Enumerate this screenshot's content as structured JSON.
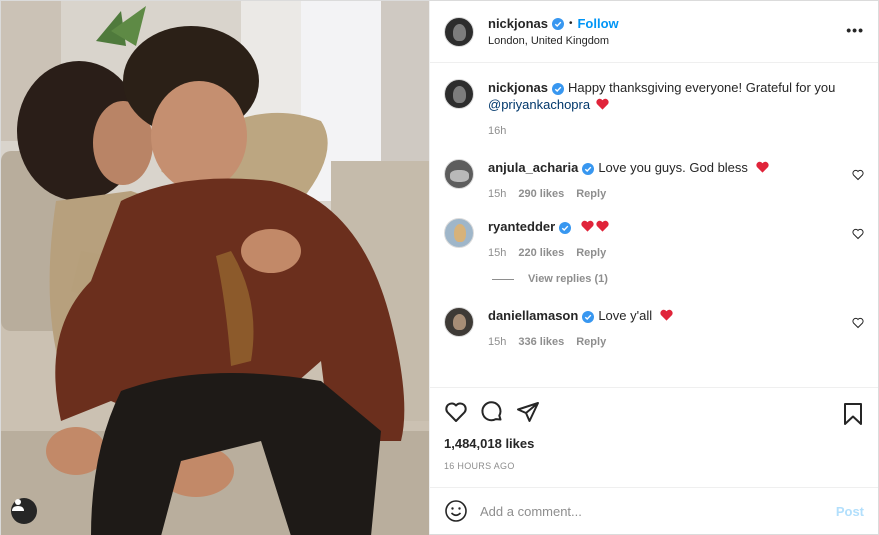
{
  "header": {
    "username": "nickjonas",
    "dot": "•",
    "follow_label": "Follow",
    "location": "London, United Kingdom",
    "more_label": "•••"
  },
  "caption": {
    "username": "nickjonas",
    "text": "Happy thanksgiving everyone! Grateful for you",
    "mention": "@priyankachopra",
    "time": "16h"
  },
  "comments": [
    {
      "username": "anjula_acharia",
      "text": "Love you guys. God bless",
      "time": "15h",
      "likes": "290 likes",
      "reply": "Reply"
    },
    {
      "username": "ryantedder",
      "text": "",
      "time": "15h",
      "likes": "220 likes",
      "reply": "Reply",
      "view_replies": "View replies (1)"
    },
    {
      "username": "daniellamason",
      "text": "Love y'all",
      "time": "15h",
      "likes": "336 likes",
      "reply": "Reply"
    }
  ],
  "post": {
    "likes": "1,484,018 likes",
    "timestamp": "16 HOURS AGO"
  },
  "add_comment": {
    "placeholder": "Add a comment...",
    "post_label": "Post"
  },
  "colors": {
    "accent": "#0095f6",
    "verified": "#3897f0",
    "heart": "#ed4956",
    "muted": "#8e8e8e"
  }
}
